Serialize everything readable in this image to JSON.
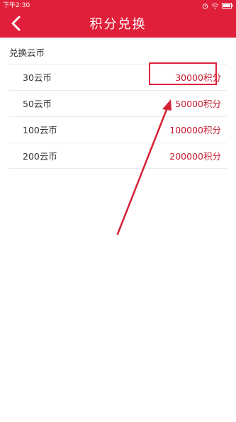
{
  "status_bar": {
    "time": "下午2:30",
    "icons": [
      "alarm-icon",
      "wifi-icon",
      "battery-icon"
    ]
  },
  "header": {
    "title": "积分兑换",
    "back_icon": "chevron-left-icon",
    "background_color": "#e0203a"
  },
  "section": {
    "title": "兑换云币"
  },
  "items": [
    {
      "label": "30云币",
      "points": "30000积分"
    },
    {
      "label": "50云币",
      "points": "50000积分"
    },
    {
      "label": "100云币",
      "points": "100000积分"
    },
    {
      "label": "200云币",
      "points": "200000积分"
    }
  ],
  "annotation": {
    "highlight_color": "#e0203a",
    "highlighted_item": "30000积分"
  }
}
